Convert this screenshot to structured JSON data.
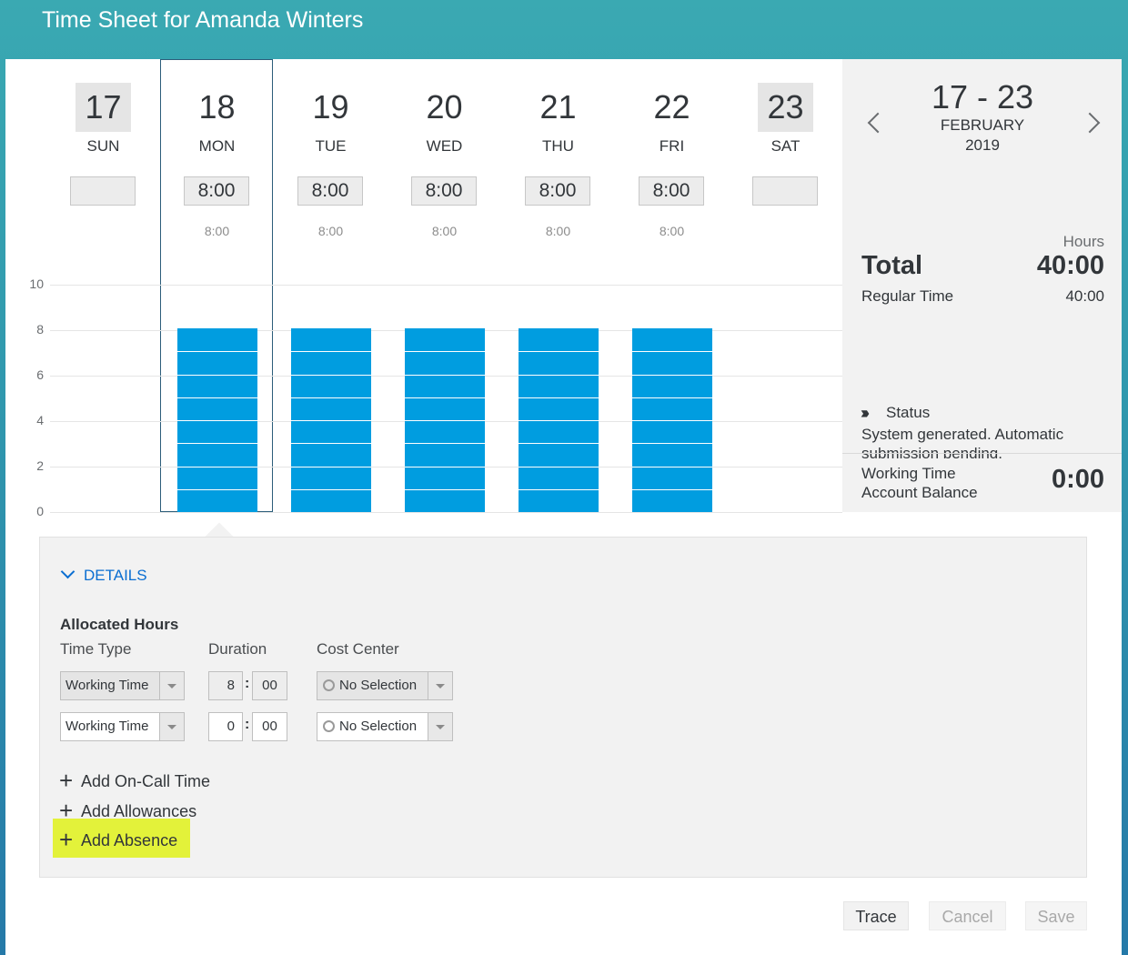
{
  "header": {
    "title": "Time Sheet for Amanda Winters"
  },
  "days": [
    {
      "num": "17",
      "name": "SUN",
      "hours": "",
      "sub": "",
      "weekend": true,
      "bar": 0
    },
    {
      "num": "18",
      "name": "MON",
      "hours": "8:00",
      "sub": "8:00",
      "weekend": false,
      "bar": 8
    },
    {
      "num": "19",
      "name": "TUE",
      "hours": "8:00",
      "sub": "8:00",
      "weekend": false,
      "bar": 8
    },
    {
      "num": "20",
      "name": "WED",
      "hours": "8:00",
      "sub": "8:00",
      "weekend": false,
      "bar": 8
    },
    {
      "num": "21",
      "name": "THU",
      "hours": "8:00",
      "sub": "8:00",
      "weekend": false,
      "bar": 8
    },
    {
      "num": "22",
      "name": "FRI",
      "hours": "8:00",
      "sub": "8:00",
      "weekend": false,
      "bar": 8
    },
    {
      "num": "23",
      "name": "SAT",
      "hours": "",
      "sub": "",
      "weekend": true,
      "bar": 0
    }
  ],
  "chart": {
    "yticks": [
      "10",
      "8",
      "6",
      "4",
      "2",
      "0"
    ],
    "ymax": 10,
    "bar_color": "#009de0"
  },
  "week": {
    "range": "17 - 23",
    "month": "FEBRUARY",
    "year": "2019"
  },
  "summary": {
    "hours_label": "Hours",
    "total_label": "Total",
    "total_value": "40:00",
    "regular_label": "Regular Time",
    "regular_value": "40:00",
    "status_label": "Status",
    "status_text": "System generated. Automatic submission pending.",
    "balance_label_1": "Working Time",
    "balance_label_2": "Account Balance",
    "balance_value": "0:00"
  },
  "details": {
    "toggle_label": "DETAILS",
    "section_title": "Allocated Hours",
    "col_time_type": "Time Type",
    "col_duration": "Duration",
    "col_cost_center": "Cost Center",
    "rows": [
      {
        "time_type": "Working Time",
        "hours": "8",
        "minutes": "00",
        "cost_center": "No Selection"
      },
      {
        "time_type": "Working Time",
        "hours": "0",
        "minutes": "00",
        "cost_center": "No Selection"
      }
    ],
    "add_on_call": "Add On-Call Time",
    "add_allowances": "Add Allowances",
    "add_absence": "Add Absence",
    "highlight_color": "#e3f23a"
  },
  "footer": {
    "trace": "Trace",
    "cancel": "Cancel",
    "save": "Save"
  }
}
